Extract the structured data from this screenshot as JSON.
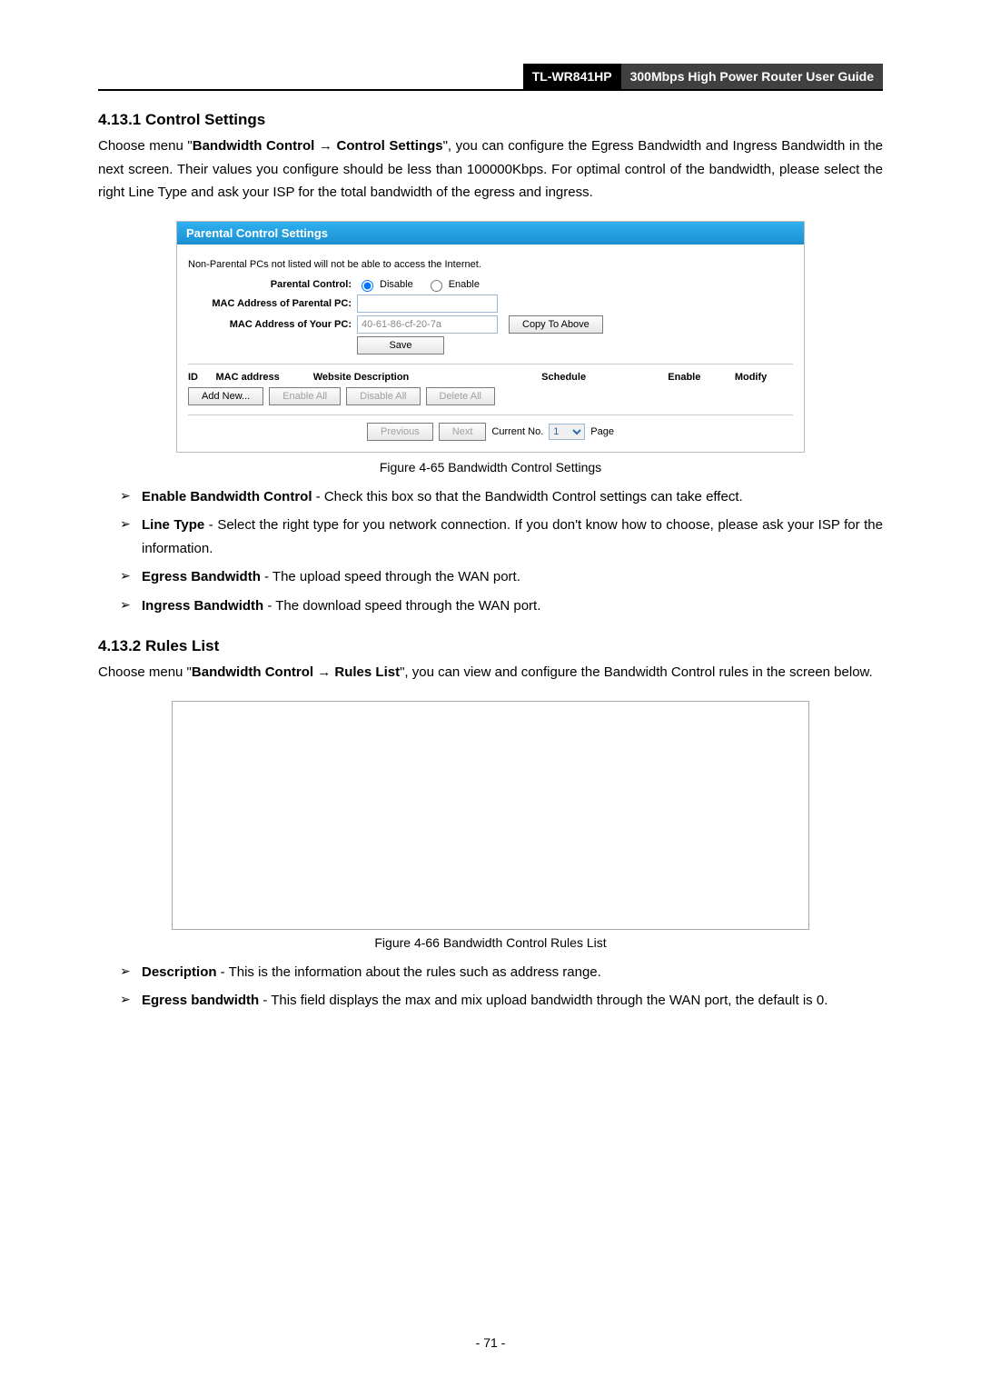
{
  "header": {
    "model": "TL-WR841HP",
    "title": "300Mbps High Power Router User Guide"
  },
  "section1": {
    "heading": "4.13.1 Control Settings",
    "intro_pre": "Choose menu \"",
    "crumb1": "Bandwidth Control",
    "crumb2": "Control Settings",
    "intro_post": "\", you can configure the Egress Bandwidth and Ingress Bandwidth in the next screen. Their values you configure should be less than 100000Kbps. For optimal control of the bandwidth, please select the right Line Type and ask your ISP for the total bandwidth of the egress and ingress."
  },
  "panel": {
    "title": "Parental Control Settings",
    "note": "Non-Parental PCs not listed will not be able to access the Internet.",
    "labels": {
      "parental_control": "Parental Control:",
      "mac_parent": "MAC Address of Parental PC:",
      "mac_your": "MAC Address of Your PC:"
    },
    "radio_disable": "Disable",
    "radio_enable": "Enable",
    "mac_your_value": "40-61-86-cf-20-7a",
    "btn_copy": "Copy To Above",
    "btn_save": "Save",
    "columns": {
      "id": "ID",
      "mac": "MAC address",
      "web": "Website Description",
      "sched": "Schedule",
      "enable": "Enable",
      "modify": "Modify"
    },
    "btns": {
      "add": "Add New...",
      "enable_all": "Enable All",
      "disable_all": "Disable All",
      "delete_all": "Delete All"
    },
    "footer": {
      "prev": "Previous",
      "next": "Next",
      "current_no": "Current No.",
      "page_value": "1",
      "page_label": "Page"
    }
  },
  "caption1": "Figure 4-65 Bandwidth Control Settings",
  "bullets1": [
    {
      "term": "Enable Bandwidth Control",
      "desc": " - Check this box so that the Bandwidth Control settings can take effect."
    },
    {
      "term": "Line Type",
      "desc": " - Select the right type for you network connection. If you don't know how to choose, please ask your ISP for the information."
    },
    {
      "term": "Egress Bandwidth",
      "desc": " - The upload speed through the WAN port."
    },
    {
      "term": "Ingress Bandwidth",
      "desc": " - The download speed through the WAN port."
    }
  ],
  "section2": {
    "heading": "4.13.2 Rules List",
    "intro_pre": "Choose menu \"",
    "crumb1": "Bandwidth Control",
    "crumb2": "Rules List",
    "intro_post": "\", you can view and configure the Bandwidth Control rules in the screen below."
  },
  "caption2": "Figure 4-66 Bandwidth Control Rules List",
  "bullets2": [
    {
      "term": "Description",
      "desc": " - This is the information about the rules such as address range."
    },
    {
      "term": "Egress bandwidth",
      "desc": " - This field displays the max and mix upload bandwidth through the WAN port, the default is 0."
    }
  ],
  "page_number": "- 71 -"
}
